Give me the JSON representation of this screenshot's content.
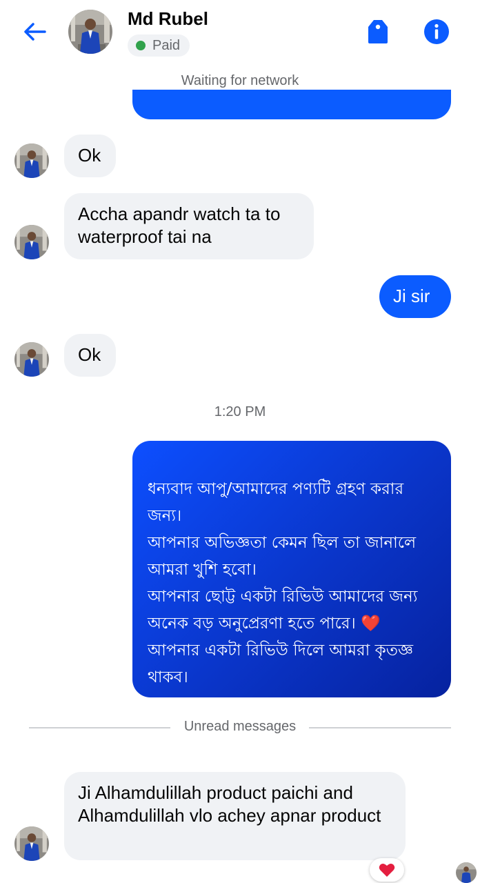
{
  "header": {
    "contact_name": "Md Rubel",
    "status_label": "Paid",
    "status_color": "#31a24c",
    "accent_color": "#0b5cff",
    "icons": [
      "back-arrow-icon",
      "tag-icon",
      "info-icon"
    ]
  },
  "network_status": "Waiting for network",
  "messages": [
    {
      "direction": "outgoing",
      "text": "",
      "partially_visible": true
    },
    {
      "direction": "incoming",
      "text": "Ok"
    },
    {
      "direction": "incoming",
      "text": "Accha apandr watch ta to waterproof tai na"
    },
    {
      "direction": "outgoing",
      "text": "Ji sir"
    },
    {
      "direction": "incoming",
      "text": "Ok"
    },
    {
      "direction": "outgoing",
      "text": "ধন্যবাদ আপু/আমাদের পণ্যটি গ্রহণ করার জন্য।\nআপনার অভিজ্ঞতা কেমন ছিল তা জানালে আমরা খুশি হবো।\nআপনার ছোট্ট একটা রিভিউ আমাদের জন্য অনেক বড় অনুপ্রেরণা হতে পারে। ❤️\nআপনার একটা রিভিউ দিলে আমরা কৃতজ্ঞ থাকব।"
    },
    {
      "direction": "incoming",
      "text": "Ji Alhamdulillah product paichi and Alhamdulillah vlo achey apnar product",
      "reaction": "heart"
    }
  ],
  "timestamp": "1:20 PM",
  "unread_divider": "Unread messages"
}
